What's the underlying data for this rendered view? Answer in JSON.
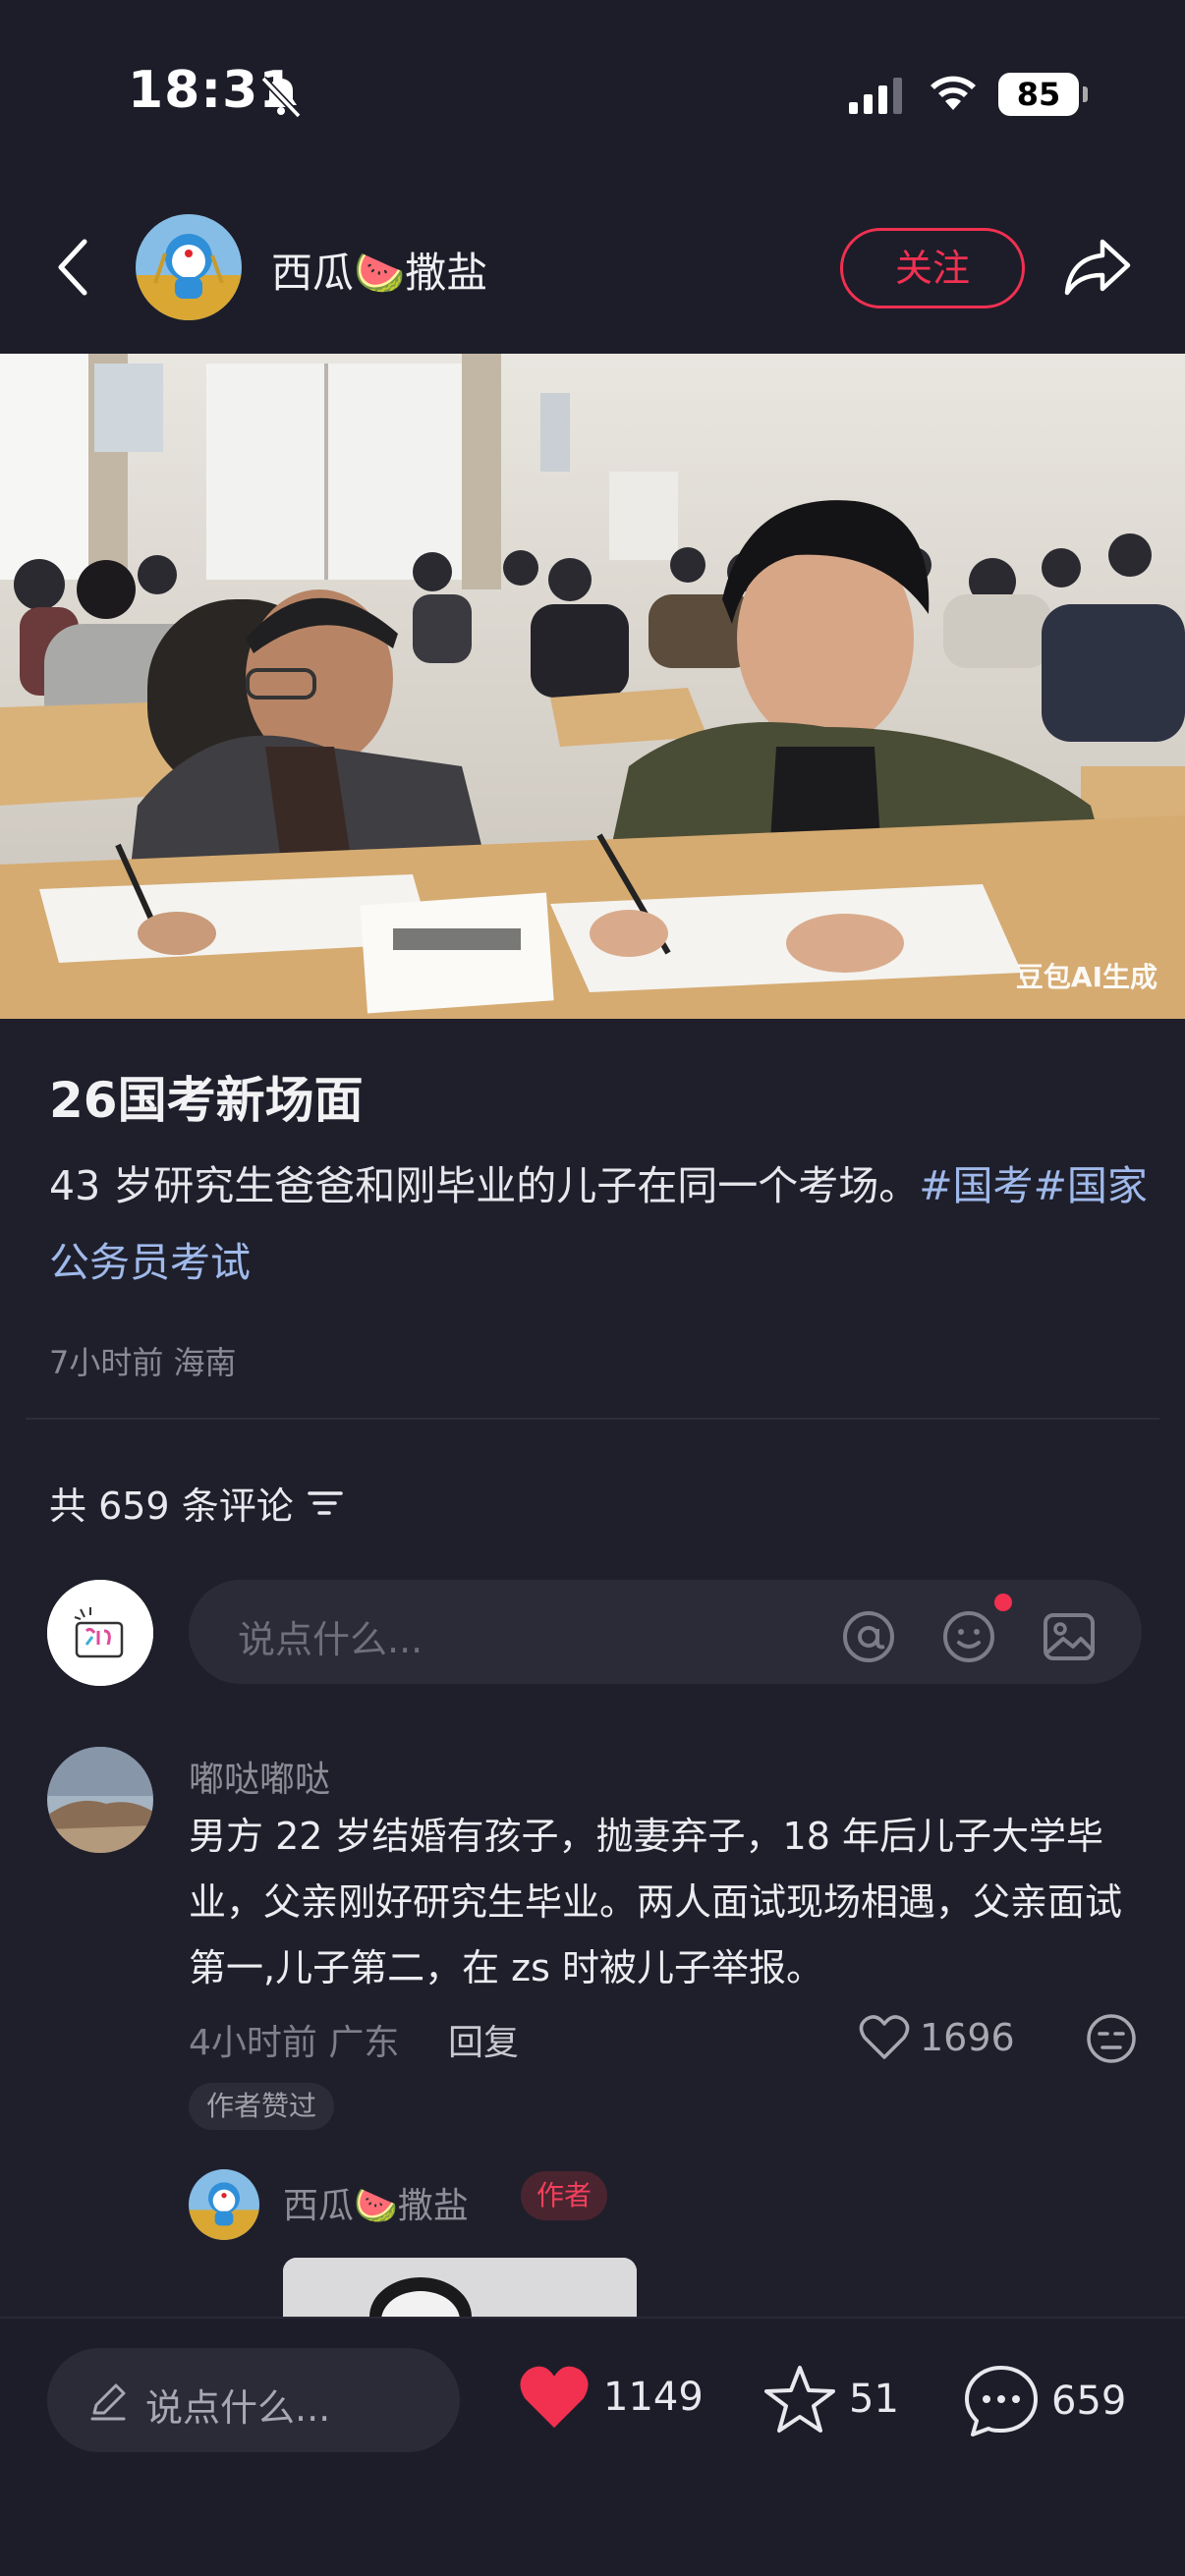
{
  "status": {
    "time": "18:31",
    "battery": "85"
  },
  "header": {
    "author": "西瓜🍉撒盐",
    "follow_label": "关注"
  },
  "photo": {
    "watermark": "豆包AI生成"
  },
  "post": {
    "title": "26国考新场面",
    "text_plain": "43 岁研究生爸爸和刚毕业的儿子在同一个考场。",
    "tag1": "#国考",
    "tag2": "#国家公务员考试",
    "meta": "7小时前 海南"
  },
  "comments_header": {
    "label": "共 659 条评论"
  },
  "comment_input": {
    "placeholder": "说点什么..."
  },
  "comment": {
    "user": "嘟哒嘟哒",
    "text": "男方 22 岁结婚有孩子，抛妻弃子，18 年后儿子大学毕业，父亲刚好研究生毕业。两人面试现场相遇，父亲面试第一,儿子第二，在 zs 时被儿子举报。",
    "meta": "4小时前 广东",
    "reply_label": "回复",
    "likes": "1696",
    "author_liked": "作者赞过"
  },
  "reply": {
    "user": "西瓜🍉撒盐",
    "badge": "作者"
  },
  "bottom_bar": {
    "placeholder": "说点什么...",
    "likes": "1149",
    "favorites": "51",
    "comments": "659"
  },
  "colors": {
    "accent": "#f23051",
    "background": "#1f1f2b",
    "tag": "#9fb9ea"
  }
}
